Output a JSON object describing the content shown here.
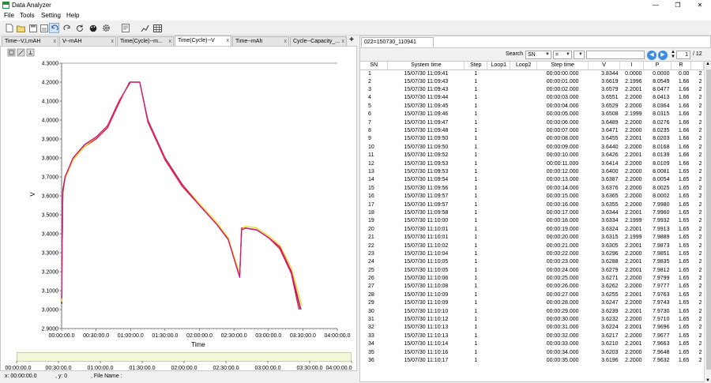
{
  "window": {
    "title": "Data Analyzer",
    "minimize_glyph": "—",
    "maximize_glyph": "❐",
    "close_glyph": "✕"
  },
  "menu": [
    "File",
    "Tools",
    "Setting",
    "Help"
  ],
  "toolbar": {
    "icons": [
      "new-icon",
      "open-icon",
      "save-icon",
      "saveas-icon",
      "undo-icon",
      "redo-icon",
      "refresh-icon",
      "palette-icon",
      "settings-icon",
      "report-icon",
      "chart-icon",
      "table-icon"
    ],
    "active_index": 4
  },
  "tabs": [
    {
      "label": "Time--V,I,mAH",
      "active": false
    },
    {
      "label": "V--mAH",
      "active": false
    },
    {
      "label": "Time(Cycle)--m...",
      "active": false
    },
    {
      "label": "Time(Cycle)--V",
      "active": true
    },
    {
      "label": "Time--mAh",
      "active": false
    },
    {
      "label": "Cycle--Capacity_...",
      "active": false
    }
  ],
  "tab_close_glyph": "x",
  "tab_add_glyph": "+",
  "chart_data": {
    "type": "line",
    "xlabel": "Time",
    "ylabel": "V",
    "ylim": [
      2.9,
      4.3
    ],
    "xlim_seconds": [
      0,
      14400
    ],
    "y_ticks": [
      "4.3000",
      "4.2000",
      "4.1000",
      "4.0000",
      "3.9000",
      "3.8000",
      "3.7000",
      "3.6000",
      "3.5000",
      "3.4000",
      "3.3000",
      "3.2000",
      "3.1000",
      "3.0000",
      "2.9000"
    ],
    "x_ticks": [
      "00:00:00.0",
      "00:30:00.0",
      "01:00:00.0",
      "01:30:00.0",
      "02:00:00.0",
      "02:30:00.0",
      "03:00:00.0",
      "03:30:00.0",
      "04:00:00.0"
    ],
    "series": [
      {
        "color": "#000000",
        "x": [
          0,
          60,
          180,
          600,
          1200,
          1800,
          2400,
          3000,
          3600,
          4020,
          4080,
          4500,
          5400,
          6300,
          7200,
          8100,
          8700,
          9300,
          9400,
          9600,
          10200,
          10800,
          11400,
          12000,
          12480
        ],
        "y": [
          3.03,
          3.63,
          3.7,
          3.8,
          3.87,
          3.91,
          3.97,
          4.1,
          4.2,
          4.2,
          4.2,
          4.0,
          3.8,
          3.66,
          3.55,
          3.45,
          3.37,
          3.18,
          3.42,
          3.43,
          3.42,
          3.38,
          3.33,
          3.2,
          3.0
        ]
      },
      {
        "color": "#e0162b",
        "x": [
          0,
          60,
          180,
          600,
          1200,
          1800,
          2400,
          3000,
          3550,
          4020,
          4080,
          4500,
          5400,
          6300,
          7200,
          8100,
          8700,
          9300,
          9400,
          9600,
          10200,
          10800,
          11400,
          12000,
          12400
        ],
        "y": [
          3.05,
          3.61,
          3.69,
          3.79,
          3.86,
          3.9,
          3.96,
          4.09,
          4.2,
          4.2,
          4.2,
          3.99,
          3.79,
          3.65,
          3.55,
          3.45,
          3.37,
          3.17,
          3.43,
          3.43,
          3.42,
          3.38,
          3.32,
          3.19,
          3.0
        ]
      },
      {
        "color": "#e8e020",
        "x": [
          0,
          60,
          180,
          600,
          1200,
          1800,
          2400,
          3000,
          3600,
          4020,
          4080,
          4500,
          5400,
          6300,
          7200,
          8100,
          8700,
          9300,
          9400,
          9600,
          10200,
          10800,
          11400,
          12000,
          12550
        ],
        "y": [
          3.04,
          3.6,
          3.69,
          3.79,
          3.86,
          3.91,
          3.97,
          4.1,
          4.2,
          4.2,
          4.2,
          4.0,
          3.8,
          3.66,
          3.56,
          3.46,
          3.38,
          3.19,
          3.42,
          3.44,
          3.43,
          3.39,
          3.34,
          3.22,
          3.02
        ]
      },
      {
        "color": "#d7168c",
        "x": [
          0,
          60,
          180,
          600,
          1200,
          1800,
          2400,
          3000,
          3580,
          4020,
          4080,
          4500,
          5400,
          6300,
          7200,
          8100,
          8700,
          9300,
          9400,
          9600,
          10200,
          10800,
          11400,
          12000,
          12500
        ],
        "y": [
          3.06,
          3.62,
          3.7,
          3.8,
          3.87,
          3.91,
          3.97,
          4.1,
          4.2,
          4.2,
          4.2,
          4.0,
          3.8,
          3.66,
          3.55,
          3.45,
          3.37,
          3.17,
          3.42,
          3.43,
          3.42,
          3.38,
          3.33,
          3.2,
          3.0
        ]
      }
    ]
  },
  "status": {
    "x_label": "x: 00:00:00.0",
    "y_label": ", y: 0",
    "file_label": ", File Name :"
  },
  "right_tab": "022=150730_110941",
  "search": {
    "label": "Search",
    "field": "SN",
    "operator": "=",
    "value": "",
    "prev_glyph": "◀",
    "next_glyph": "▶",
    "page": "1",
    "total": "/ 12"
  },
  "table": {
    "columns": [
      "SN",
      "System time",
      "Step",
      "Loop1",
      "Loop2",
      "Step time",
      "V",
      "I",
      "P",
      "R",
      ""
    ],
    "rows": [
      [
        "1",
        "15/07/30 11:09:41",
        "1",
        "",
        "",
        "00:00:00.000",
        "3.8344",
        "0.0000",
        "0.0000",
        "0.00",
        "2"
      ],
      [
        "2",
        "15/07/30 11:09:43",
        "1",
        "",
        "",
        "00:00:01.000",
        "3.6619",
        "2.1996",
        "8.0549",
        "1.66",
        "2"
      ],
      [
        "3",
        "15/07/30 11:09:43",
        "1",
        "",
        "",
        "00:00:02.000",
        "3.6579",
        "2.2001",
        "8.0477",
        "1.66",
        "2"
      ],
      [
        "4",
        "15/07/30 11:09:44",
        "1",
        "",
        "",
        "00:00:03.000",
        "3.6551",
        "2.2000",
        "8.0413",
        "1.66",
        "2"
      ],
      [
        "5",
        "15/07/30 11:09:45",
        "1",
        "",
        "",
        "00:00:04.000",
        "3.6529",
        "2.2000",
        "8.0364",
        "1.66",
        "2"
      ],
      [
        "6",
        "15/07/30 11:09:46",
        "1",
        "",
        "",
        "00:00:05.000",
        "3.6508",
        "2.1999",
        "8.0315",
        "1.66",
        "2"
      ],
      [
        "7",
        "15/07/30 11:09:47",
        "1",
        "",
        "",
        "00:00:06.000",
        "3.6489",
        "2.2000",
        "8.0276",
        "1.66",
        "2"
      ],
      [
        "8",
        "15/07/30 11:09:48",
        "1",
        "",
        "",
        "00:00:07.000",
        "3.6471",
        "2.2000",
        "8.0235",
        "1.66",
        "2"
      ],
      [
        "9",
        "15/07/30 11:09:50",
        "1",
        "",
        "",
        "00:00:08.000",
        "3.6455",
        "2.2001",
        "8.0203",
        "1.66",
        "2"
      ],
      [
        "10",
        "15/07/30 11:09:50",
        "1",
        "",
        "",
        "00:00:09.000",
        "3.6440",
        "2.2000",
        "8.0168",
        "1.66",
        "2"
      ],
      [
        "11",
        "15/07/30 11:09:52",
        "1",
        "",
        "",
        "00:00:10.000",
        "3.6426",
        "2.2001",
        "8.0139",
        "1.66",
        "2"
      ],
      [
        "12",
        "15/07/30 11:09:53",
        "1",
        "",
        "",
        "00:00:11.000",
        "3.6414",
        "2.2000",
        "8.0109",
        "1.66",
        "2"
      ],
      [
        "13",
        "15/07/30 11:09:53",
        "1",
        "",
        "",
        "00:00:12.000",
        "3.6400",
        "2.2000",
        "8.0081",
        "1.65",
        "2"
      ],
      [
        "14",
        "15/07/30 11:09:54",
        "1",
        "",
        "",
        "00:00:13.000",
        "3.6387",
        "2.2000",
        "8.0054",
        "1.65",
        "2"
      ],
      [
        "15",
        "15/07/30 11:09:56",
        "1",
        "",
        "",
        "00:00:14.000",
        "3.6376",
        "2.2000",
        "8.0025",
        "1.65",
        "2"
      ],
      [
        "16",
        "15/07/30 11:09:57",
        "1",
        "",
        "",
        "00:00:15.000",
        "3.6365",
        "2.2000",
        "8.0002",
        "1.65",
        "2"
      ],
      [
        "17",
        "15/07/30 11:09:57",
        "1",
        "",
        "",
        "00:00:16.000",
        "3.6355",
        "2.2000",
        "7.9980",
        "1.65",
        "2"
      ],
      [
        "18",
        "15/07/30 11:09:58",
        "1",
        "",
        "",
        "00:00:17.000",
        "3.6344",
        "2.2001",
        "7.9960",
        "1.65",
        "2"
      ],
      [
        "19",
        "15/07/30 11:10:00",
        "1",
        "",
        "",
        "00:00:18.000",
        "3.6334",
        "2.1999",
        "7.9932",
        "1.65",
        "2"
      ],
      [
        "20",
        "15/07/30 11:10:01",
        "1",
        "",
        "",
        "00:00:19.000",
        "3.6324",
        "2.2001",
        "7.9913",
        "1.65",
        "2"
      ],
      [
        "21",
        "15/07/30 11:10:01",
        "1",
        "",
        "",
        "00:00:20.000",
        "3.6315",
        "2.1999",
        "7.9889",
        "1.65",
        "2"
      ],
      [
        "22",
        "15/07/30 11:10:02",
        "1",
        "",
        "",
        "00:00:21.000",
        "3.6305",
        "2.2001",
        "7.9873",
        "1.65",
        "2"
      ],
      [
        "23",
        "15/07/30 11:10:04",
        "1",
        "",
        "",
        "00:00:22.000",
        "3.6296",
        "2.2000",
        "7.9851",
        "1.65",
        "2"
      ],
      [
        "24",
        "15/07/30 11:10:05",
        "1",
        "",
        "",
        "00:00:23.000",
        "3.6288",
        "2.2001",
        "7.9835",
        "1.65",
        "2"
      ],
      [
        "25",
        "15/07/30 11:10:05",
        "1",
        "",
        "",
        "00:00:24.000",
        "3.6279",
        "2.2001",
        "7.9812",
        "1.65",
        "2"
      ],
      [
        "26",
        "15/07/30 11:10:06",
        "1",
        "",
        "",
        "00:00:25.000",
        "3.6271",
        "2.2000",
        "7.9799",
        "1.65",
        "2"
      ],
      [
        "27",
        "15/07/30 11:10:08",
        "1",
        "",
        "",
        "00:00:26.000",
        "3.6262",
        "2.2000",
        "7.9777",
        "1.65",
        "2"
      ],
      [
        "28",
        "15/07/30 11:10:09",
        "1",
        "",
        "",
        "00:00:27.000",
        "3.6255",
        "2.2001",
        "7.9763",
        "1.65",
        "2"
      ],
      [
        "29",
        "15/07/30 11:10:09",
        "1",
        "",
        "",
        "00:00:28.000",
        "3.6247",
        "2.2000",
        "7.9743",
        "1.65",
        "2"
      ],
      [
        "30",
        "15/07/30 11:10:10",
        "1",
        "",
        "",
        "00:00:29.000",
        "3.6239",
        "2.2001",
        "7.9730",
        "1.65",
        "2"
      ],
      [
        "31",
        "15/07/30 11:10:12",
        "1",
        "",
        "",
        "00:00:30.000",
        "3.6232",
        "2.2000",
        "7.9710",
        "1.65",
        "2"
      ],
      [
        "32",
        "15/07/30 11:10:13",
        "1",
        "",
        "",
        "00:00:31.000",
        "3.6224",
        "2.2001",
        "7.9696",
        "1.65",
        "2"
      ],
      [
        "33",
        "15/07/30 11:10:13",
        "1",
        "",
        "",
        "00:00:32.000",
        "3.6217",
        "2.2000",
        "7.9677",
        "1.65",
        "2"
      ],
      [
        "34",
        "15/07/30 11:10:14",
        "1",
        "",
        "",
        "00:00:33.000",
        "3.6210",
        "2.2001",
        "7.9663",
        "1.65",
        "2"
      ],
      [
        "35",
        "15/07/30 11:10:16",
        "1",
        "",
        "",
        "00:00:34.000",
        "3.6203",
        "2.2000",
        "7.9648",
        "1.65",
        "2"
      ],
      [
        "36",
        "15/07/30 11:10:17",
        "1",
        "",
        "",
        "00:00:35.000",
        "3.6196",
        "2.2000",
        "7.9632",
        "1.65",
        "2"
      ]
    ]
  }
}
